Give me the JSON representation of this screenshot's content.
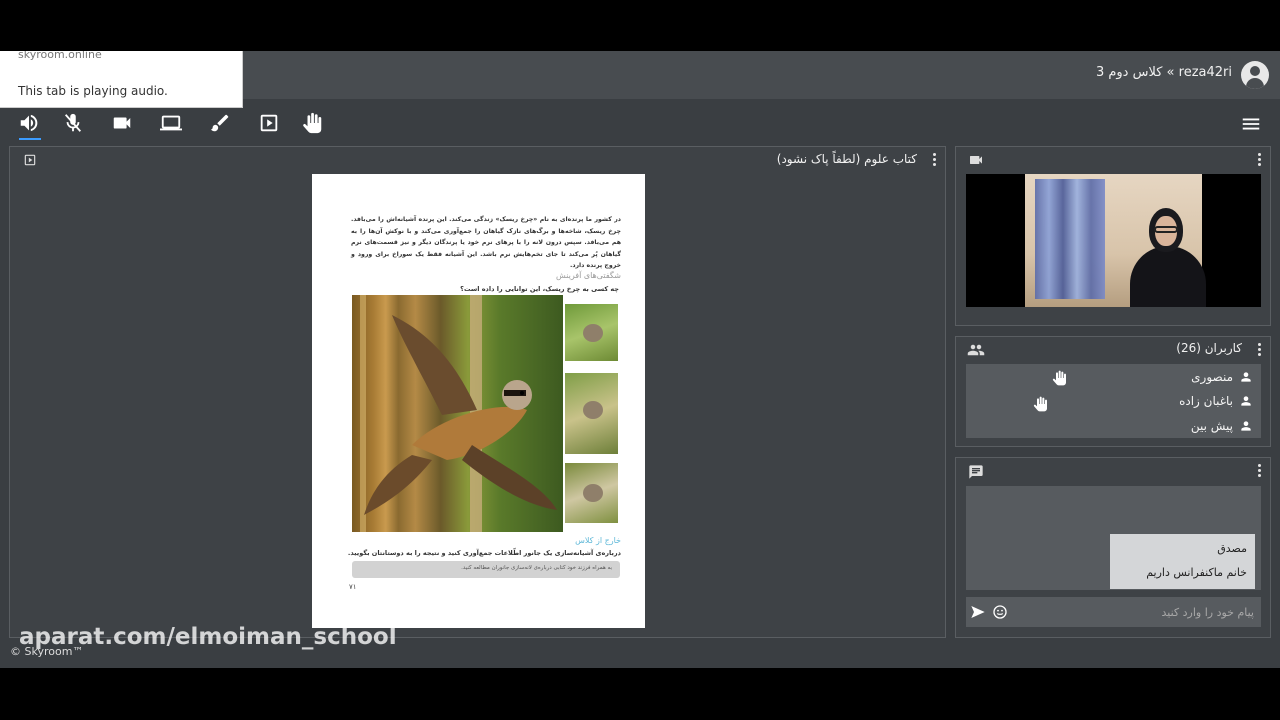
{
  "header": {
    "title": "reza42ri » کلاس دوم 3"
  },
  "toast": {
    "domain": "skyroom.online",
    "message": "This tab is playing audio."
  },
  "toolbar": {
    "icons": [
      "speaker-icon",
      "mic-off-icon",
      "camera-icon",
      "laptop-icon",
      "brush-icon",
      "play-box-icon",
      "hand-icon"
    ],
    "menu_icon": "hamburger-icon"
  },
  "main_panel": {
    "title": "کتاب علوم (لطفاً پاک نشود)",
    "page": {
      "paragraph": "در کشور ما پرنده‌ای به نام «چرخ ریسک» زندگی می‌کند. این پرنده آشیانه‌اش را می‌بافد. چرخ ریسک، شاخه‌ها و برگ‌های نازک گیاهان را جمع‌آوری می‌کند و با نوکش آن‌ها را به هم می‌بافد. سپس درون لانه را با پرهای نرم خود یا پرندگان دیگر و نیز قسمت‌های نرم گیاهان پُر می‌کند تا جای تخم‌هایش نرم باشد. این آشیانه فقط یک سوراخ برای ورود و خروج پرنده دارد.",
      "subheading": "شگفتی‌های آفرینش",
      "question": "چه کسی به چرخ ریسک، این توانایی را داده است؟",
      "heading2": "خارج از کلاس",
      "task": "درباره‌ی آشیانه‌سازی یک جانور اطّلاعات جمع‌آوری کنید و نتیجه را به دوستانتان بگویید.",
      "note": "به همراه فرزند خود کتابی درباره‌ی لانه‌سازی جانوران مطالعه کنید.",
      "page_number": "۷۱"
    }
  },
  "users_panel": {
    "title": "کاربران (26)",
    "users": [
      {
        "name": "منصوری",
        "hand_raised": true
      },
      {
        "name": "باغبان زاده",
        "hand_raised": true
      },
      {
        "name": "پیش بین",
        "hand_raised": false
      }
    ]
  },
  "chat_panel": {
    "messages": [
      {
        "sender": "مصدق",
        "text": "خانم ماکنفرانس داریم"
      }
    ],
    "input_placeholder": "پیام خود را وارد کنید"
  },
  "overlay": {
    "watermark": "aparat.com/elmoiman_school",
    "brand": "© Skyroom™"
  },
  "colors": {
    "background": "#3a3e42",
    "panel": "#4a4e52",
    "accent": "#3c9cff"
  }
}
